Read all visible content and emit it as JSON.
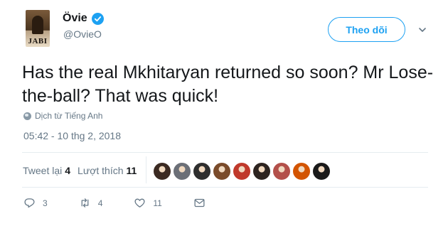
{
  "author": {
    "display_name": "Övie",
    "handle": "@OvieO",
    "avatar_text": "JABI"
  },
  "follow_label": "Theo dõi",
  "tweet": {
    "text": "Has the real Mkhitaryan returned so soon? Mr Lose-the-ball? That was quick!",
    "translate_label": "Dịch từ Tiếng Anh",
    "timestamp": "05:42 - 10 thg 2, 2018"
  },
  "stats": {
    "retweets_label": "Tweet lại",
    "retweets_count": "4",
    "likes_label": "Lượt thích",
    "likes_count": "11"
  },
  "liker_avatars": [
    {
      "name": "liker-avatar-1",
      "color": "#3b2a22"
    },
    {
      "name": "liker-avatar-2",
      "color": "#6b6f77"
    },
    {
      "name": "liker-avatar-3",
      "color": "#2e2e2e"
    },
    {
      "name": "liker-avatar-4",
      "color": "#7a4b2a"
    },
    {
      "name": "liker-avatar-5",
      "color": "#c0392b"
    },
    {
      "name": "liker-avatar-6",
      "color": "#2d2420"
    },
    {
      "name": "liker-avatar-7",
      "color": "#b3504a"
    },
    {
      "name": "liker-avatar-8",
      "color": "#d35400"
    },
    {
      "name": "liker-avatar-9",
      "color": "#1a1a1a"
    }
  ],
  "actions": {
    "reply_count": "3",
    "retweet_count": "4",
    "like_count": "11"
  },
  "icons": {
    "verified": "verified-badge-icon",
    "chevron": "chevron-down-icon",
    "globe": "globe-icon",
    "reply": "reply-icon",
    "retweet": "retweet-icon",
    "like": "heart-icon",
    "message": "direct-message-icon"
  },
  "colors": {
    "accent": "#1da1f2",
    "text": "#14171a",
    "muted": "#657786",
    "divider": "#e6ecf0"
  }
}
